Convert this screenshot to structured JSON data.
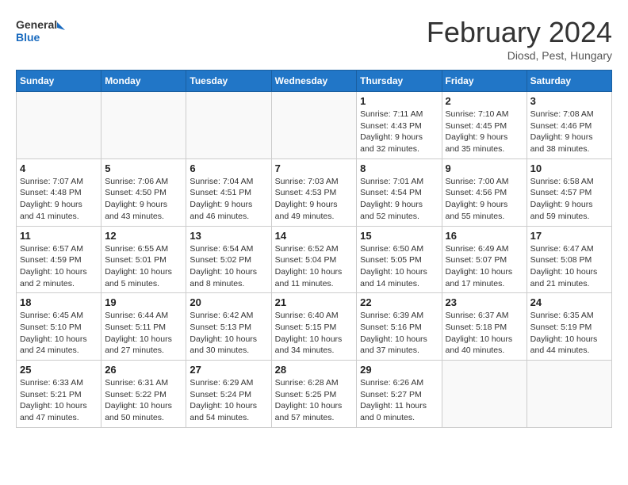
{
  "header": {
    "logo_line1": "General",
    "logo_line2": "Blue",
    "month_title": "February 2024",
    "subtitle": "Diosd, Pest, Hungary"
  },
  "days_of_week": [
    "Sunday",
    "Monday",
    "Tuesday",
    "Wednesday",
    "Thursday",
    "Friday",
    "Saturday"
  ],
  "weeks": [
    [
      {
        "day": "",
        "info": ""
      },
      {
        "day": "",
        "info": ""
      },
      {
        "day": "",
        "info": ""
      },
      {
        "day": "",
        "info": ""
      },
      {
        "day": "1",
        "info": "Sunrise: 7:11 AM\nSunset: 4:43 PM\nDaylight: 9 hours\nand 32 minutes."
      },
      {
        "day": "2",
        "info": "Sunrise: 7:10 AM\nSunset: 4:45 PM\nDaylight: 9 hours\nand 35 minutes."
      },
      {
        "day": "3",
        "info": "Sunrise: 7:08 AM\nSunset: 4:46 PM\nDaylight: 9 hours\nand 38 minutes."
      }
    ],
    [
      {
        "day": "4",
        "info": "Sunrise: 7:07 AM\nSunset: 4:48 PM\nDaylight: 9 hours\nand 41 minutes."
      },
      {
        "day": "5",
        "info": "Sunrise: 7:06 AM\nSunset: 4:50 PM\nDaylight: 9 hours\nand 43 minutes."
      },
      {
        "day": "6",
        "info": "Sunrise: 7:04 AM\nSunset: 4:51 PM\nDaylight: 9 hours\nand 46 minutes."
      },
      {
        "day": "7",
        "info": "Sunrise: 7:03 AM\nSunset: 4:53 PM\nDaylight: 9 hours\nand 49 minutes."
      },
      {
        "day": "8",
        "info": "Sunrise: 7:01 AM\nSunset: 4:54 PM\nDaylight: 9 hours\nand 52 minutes."
      },
      {
        "day": "9",
        "info": "Sunrise: 7:00 AM\nSunset: 4:56 PM\nDaylight: 9 hours\nand 55 minutes."
      },
      {
        "day": "10",
        "info": "Sunrise: 6:58 AM\nSunset: 4:57 PM\nDaylight: 9 hours\nand 59 minutes."
      }
    ],
    [
      {
        "day": "11",
        "info": "Sunrise: 6:57 AM\nSunset: 4:59 PM\nDaylight: 10 hours\nand 2 minutes."
      },
      {
        "day": "12",
        "info": "Sunrise: 6:55 AM\nSunset: 5:01 PM\nDaylight: 10 hours\nand 5 minutes."
      },
      {
        "day": "13",
        "info": "Sunrise: 6:54 AM\nSunset: 5:02 PM\nDaylight: 10 hours\nand 8 minutes."
      },
      {
        "day": "14",
        "info": "Sunrise: 6:52 AM\nSunset: 5:04 PM\nDaylight: 10 hours\nand 11 minutes."
      },
      {
        "day": "15",
        "info": "Sunrise: 6:50 AM\nSunset: 5:05 PM\nDaylight: 10 hours\nand 14 minutes."
      },
      {
        "day": "16",
        "info": "Sunrise: 6:49 AM\nSunset: 5:07 PM\nDaylight: 10 hours\nand 17 minutes."
      },
      {
        "day": "17",
        "info": "Sunrise: 6:47 AM\nSunset: 5:08 PM\nDaylight: 10 hours\nand 21 minutes."
      }
    ],
    [
      {
        "day": "18",
        "info": "Sunrise: 6:45 AM\nSunset: 5:10 PM\nDaylight: 10 hours\nand 24 minutes."
      },
      {
        "day": "19",
        "info": "Sunrise: 6:44 AM\nSunset: 5:11 PM\nDaylight: 10 hours\nand 27 minutes."
      },
      {
        "day": "20",
        "info": "Sunrise: 6:42 AM\nSunset: 5:13 PM\nDaylight: 10 hours\nand 30 minutes."
      },
      {
        "day": "21",
        "info": "Sunrise: 6:40 AM\nSunset: 5:15 PM\nDaylight: 10 hours\nand 34 minutes."
      },
      {
        "day": "22",
        "info": "Sunrise: 6:39 AM\nSunset: 5:16 PM\nDaylight: 10 hours\nand 37 minutes."
      },
      {
        "day": "23",
        "info": "Sunrise: 6:37 AM\nSunset: 5:18 PM\nDaylight: 10 hours\nand 40 minutes."
      },
      {
        "day": "24",
        "info": "Sunrise: 6:35 AM\nSunset: 5:19 PM\nDaylight: 10 hours\nand 44 minutes."
      }
    ],
    [
      {
        "day": "25",
        "info": "Sunrise: 6:33 AM\nSunset: 5:21 PM\nDaylight: 10 hours\nand 47 minutes."
      },
      {
        "day": "26",
        "info": "Sunrise: 6:31 AM\nSunset: 5:22 PM\nDaylight: 10 hours\nand 50 minutes."
      },
      {
        "day": "27",
        "info": "Sunrise: 6:29 AM\nSunset: 5:24 PM\nDaylight: 10 hours\nand 54 minutes."
      },
      {
        "day": "28",
        "info": "Sunrise: 6:28 AM\nSunset: 5:25 PM\nDaylight: 10 hours\nand 57 minutes."
      },
      {
        "day": "29",
        "info": "Sunrise: 6:26 AM\nSunset: 5:27 PM\nDaylight: 11 hours\nand 0 minutes."
      },
      {
        "day": "",
        "info": ""
      },
      {
        "day": "",
        "info": ""
      }
    ]
  ]
}
